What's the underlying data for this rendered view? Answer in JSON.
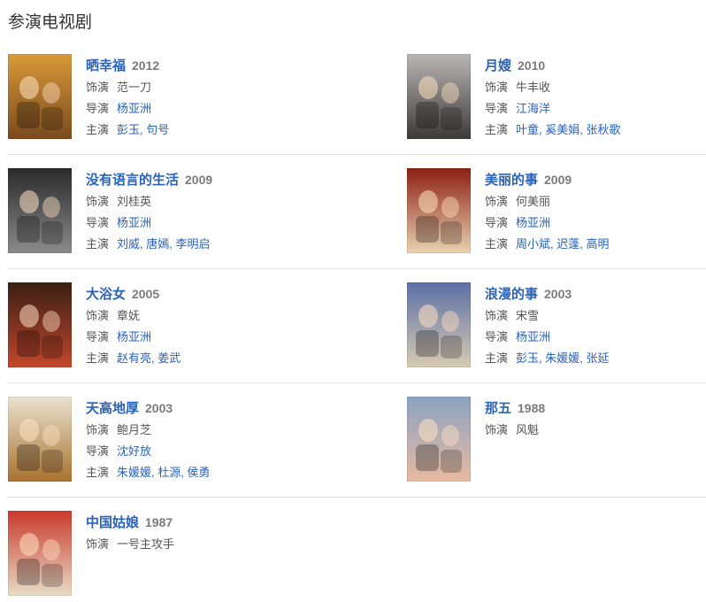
{
  "section": {
    "title": "参演电视剧"
  },
  "labels": {
    "role": "饰演",
    "director": "导演",
    "starring": "主演",
    "name_sep": ", "
  },
  "dramas": [
    {
      "title": "晒幸福",
      "year": "2012",
      "role": "范一刀",
      "director": [
        "杨亚洲"
      ],
      "starring": [
        "彭玉",
        "句号"
      ],
      "poster_icon": "poster-shaixingfu",
      "poster_colors": [
        "#d89a3a",
        "#7a4a1e"
      ]
    },
    {
      "title": "月嫂",
      "year": "2010",
      "role": "牛丰收",
      "director": [
        "江海洋"
      ],
      "starring": [
        "叶童",
        "奚美娟",
        "张秋歌"
      ],
      "poster_icon": "poster-yuesao",
      "poster_colors": [
        "#b9b6b4",
        "#3d3a3a"
      ]
    },
    {
      "title": "没有语言的生活",
      "year": "2009",
      "role": "刘桂英",
      "director": [
        "杨亚洲"
      ],
      "starring": [
        "刘威",
        "唐嫣",
        "李明启"
      ],
      "poster_icon": "poster-meiyouyuyan",
      "poster_colors": [
        "#2a2a2a",
        "#8a8a8a"
      ]
    },
    {
      "title": "美丽的事",
      "year": "2009",
      "role": "何美丽",
      "director": [
        "杨亚洲"
      ],
      "starring": [
        "周小斌",
        "迟蓬",
        "高明"
      ],
      "poster_icon": "poster-meilideshi",
      "poster_colors": [
        "#8c1f14",
        "#e8d3b0"
      ]
    },
    {
      "title": "大浴女",
      "year": "2005",
      "role": "章妩",
      "director": [
        "杨亚洲"
      ],
      "starring": [
        "赵有亮",
        "姜武"
      ],
      "poster_icon": "poster-dayunv",
      "poster_colors": [
        "#3a1f14",
        "#c2472b"
      ]
    },
    {
      "title": "浪漫的事",
      "year": "2003",
      "role": "宋雪",
      "director": [
        "杨亚洲"
      ],
      "starring": [
        "彭玉",
        "朱媛媛",
        "张延"
      ],
      "poster_icon": "poster-langmandeshi",
      "poster_colors": [
        "#5c6fa6",
        "#d9cbb2"
      ]
    },
    {
      "title": "天高地厚",
      "year": "2003",
      "role": "鲍月芝",
      "director": [
        "沈好放"
      ],
      "starring": [
        "朱媛媛",
        "杜源",
        "侯勇"
      ],
      "poster_icon": "poster-tiangaodihou",
      "poster_colors": [
        "#e9e2cf",
        "#a9722e"
      ]
    },
    {
      "title": "那五",
      "year": "1988",
      "role": "风魁",
      "director": [],
      "starring": [],
      "poster_icon": "poster-nawu",
      "poster_colors": [
        "#8aa4c2",
        "#e8b9a0"
      ]
    },
    {
      "title": "中国姑娘",
      "year": "1987",
      "role": "一号主攻手",
      "director": [],
      "starring": [],
      "poster_icon": "poster-zhongguoguniang",
      "poster_colors": [
        "#c93a2c",
        "#e8dcc6"
      ]
    }
  ]
}
